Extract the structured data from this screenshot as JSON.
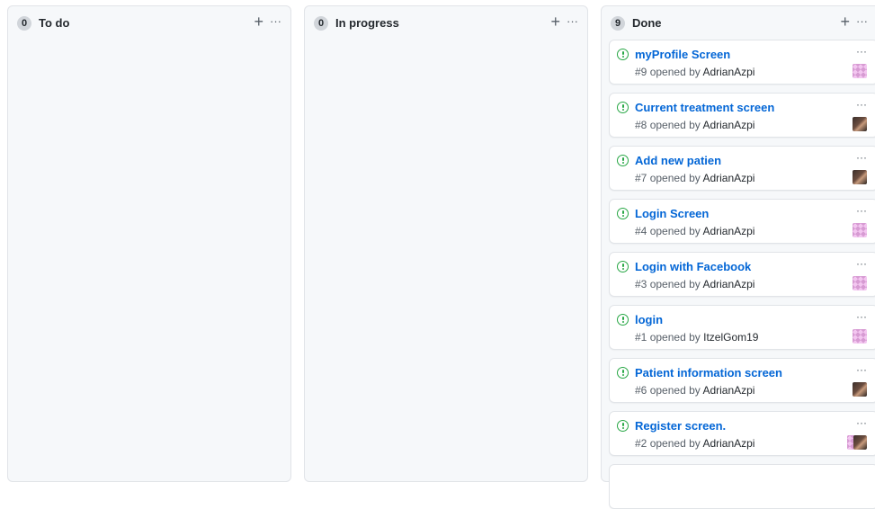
{
  "columns": [
    {
      "count": "0",
      "title": "To do",
      "add": "+",
      "menu": "···"
    },
    {
      "count": "0",
      "title": "In progress",
      "add": "+",
      "menu": "···"
    },
    {
      "count": "9",
      "title": "Done",
      "add": "+",
      "menu": "···"
    }
  ],
  "cards": [
    {
      "title": "myProfile Screen",
      "number": "#9",
      "opened_by": "opened by",
      "author": "AdrianAzpi",
      "menu": "···",
      "avatar": "identicon-avatar"
    },
    {
      "title": "Current treatment screen",
      "number": "#8",
      "opened_by": "opened by",
      "author": "AdrianAzpi",
      "menu": "···",
      "avatar": "photo-avatar"
    },
    {
      "title": "Add new patien",
      "number": "#7",
      "opened_by": "opened by",
      "author": "AdrianAzpi",
      "menu": "···",
      "avatar": "photo-avatar"
    },
    {
      "title": "Login Screen",
      "number": "#4",
      "opened_by": "opened by",
      "author": "AdrianAzpi",
      "menu": "···",
      "avatar": "identicon-avatar"
    },
    {
      "title": "Login with Facebook",
      "number": "#3",
      "opened_by": "opened by",
      "author": "AdrianAzpi",
      "menu": "···",
      "avatar": "identicon-avatar"
    },
    {
      "title": "login",
      "number": "#1",
      "opened_by": "opened by",
      "author": "ItzelGom19",
      "menu": "···",
      "avatar": "identicon-avatar"
    },
    {
      "title": "Patient information screen",
      "number": "#6",
      "opened_by": "opened by",
      "author": "AdrianAzpi",
      "menu": "···",
      "avatar": "photo-avatar"
    },
    {
      "title": "Register screen.",
      "number": "#2",
      "opened_by": "opened by",
      "author": "AdrianAzpi",
      "menu": "···",
      "avatar": "identicon-and-photo-avatars"
    }
  ],
  "colors": {
    "issue_open": "#28a745",
    "link": "#0366d6",
    "column_bg": "#f6f8fa",
    "border": "#e1e4e8"
  }
}
